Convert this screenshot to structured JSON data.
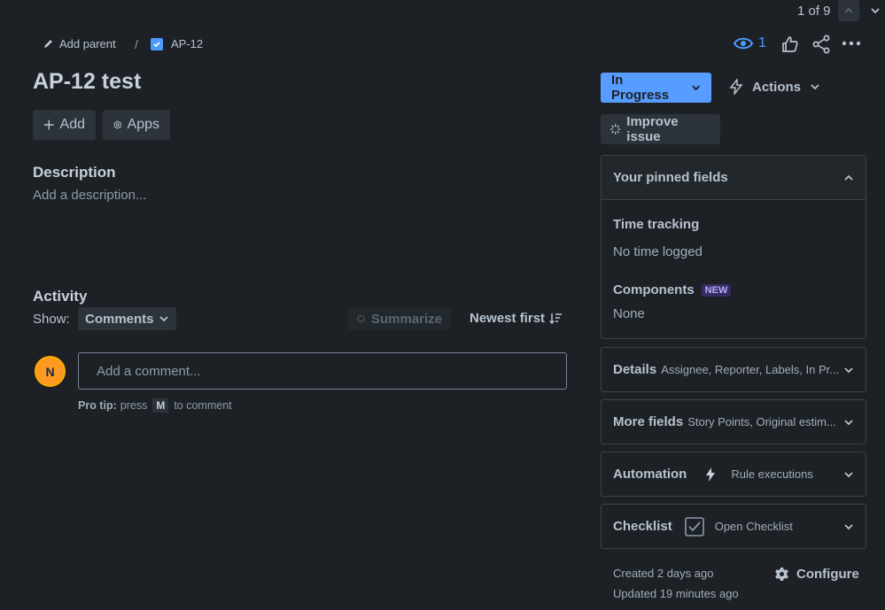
{
  "pager": {
    "text": "1 of 9",
    "up_icon": "chevron-up-icon",
    "down_icon": "chevron-down-icon"
  },
  "breadcrumb": {
    "add_parent_label": "Add parent",
    "separator": "/",
    "issue_key": "AP-12"
  },
  "header": {
    "watch_count": "1"
  },
  "issue": {
    "title": "AP-12 test"
  },
  "toolbar": {
    "add_label": "Add",
    "apps_label": "Apps"
  },
  "description": {
    "heading": "Description",
    "placeholder": "Add a description..."
  },
  "activity": {
    "heading": "Activity",
    "show_label": "Show:",
    "filter_value": "Comments",
    "summarize_label": "Summarize",
    "sort_label": "Newest first",
    "avatar_initial": "N",
    "comment_placeholder": "Add a comment...",
    "protip_bold": "Pro tip:",
    "protip_press": "press",
    "protip_key": "M",
    "protip_suffix": "to comment"
  },
  "sidebar": {
    "status_label": "In Progress",
    "actions_label": "Actions",
    "improve_label": "Improve issue",
    "pinned": {
      "title": "Your pinned fields",
      "time_tracking_label": "Time tracking",
      "time_tracking_value": "No time logged",
      "components_label": "Components",
      "components_badge": "NEW",
      "components_value": "None"
    },
    "details": {
      "title": "Details",
      "summary": "Assignee, Reporter, Labels, In Pr..."
    },
    "more_fields": {
      "title": "More fields",
      "summary": "Story Points, Original estim..."
    },
    "automation": {
      "title": "Automation",
      "summary": "Rule executions"
    },
    "checklist": {
      "title": "Checklist",
      "summary": "Open Checklist"
    },
    "created": "Created 2 days ago",
    "updated": "Updated 19 minutes ago",
    "configure_label": "Configure"
  },
  "colors": {
    "background": "#1d2125",
    "status_blue": "#579dff",
    "avatar_orange": "#ff991f",
    "new_badge": "#352c63"
  }
}
